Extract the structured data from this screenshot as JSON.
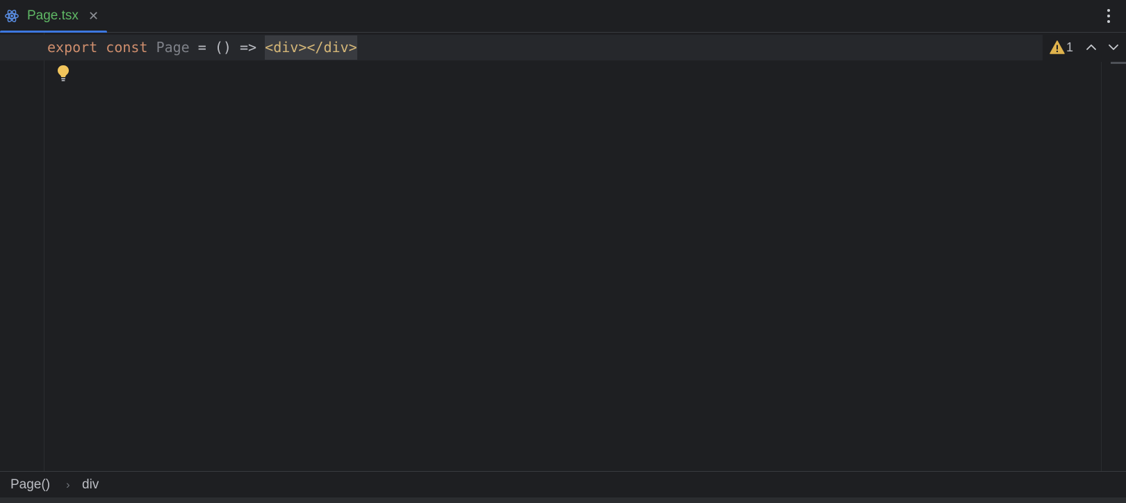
{
  "tabs": [
    {
      "label": "Page.tsx",
      "icon": "react-icon",
      "close_label": "✕",
      "active": true,
      "label_color": "#5fb865"
    }
  ],
  "toolbar": {
    "more_menu_icon": "more-vertical-icon"
  },
  "editor": {
    "code_line": {
      "kw_export": "export",
      "kw_const": "const",
      "identifier": "Page",
      "op_equals": "=",
      "parens": "()",
      "arrow": "=>",
      "jsx": "<div></div>"
    },
    "intention_icon": "lightbulb-icon"
  },
  "inspection": {
    "warning_icon": "warning-icon",
    "warning_count": "1",
    "prev_icon": "chevron-up-icon",
    "next_icon": "chevron-down-icon"
  },
  "breadcrumb": {
    "items": [
      "Page()",
      "div"
    ],
    "separator": "›"
  },
  "colors": {
    "background": "#1e1f22",
    "keyword": "#cf8e6d",
    "tag": "#d5b778",
    "accent": "#3d78e0",
    "warning": "#e0b34d"
  }
}
